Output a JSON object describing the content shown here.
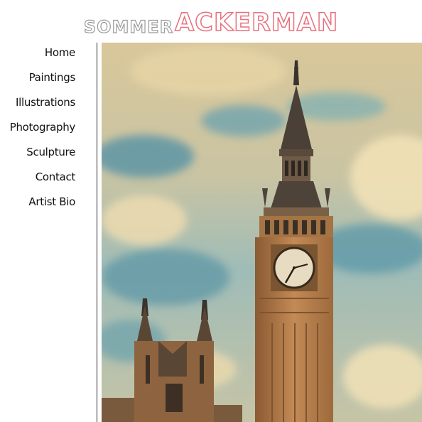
{
  "site": {
    "logo_first": "SOMMER",
    "logo_last": "ACKERMAN"
  },
  "nav": {
    "items": [
      {
        "label": "Home"
      },
      {
        "label": "Paintings"
      },
      {
        "label": "Illustrations"
      },
      {
        "label": "Photography"
      },
      {
        "label": "Sculpture"
      },
      {
        "label": "Contact"
      },
      {
        "label": "Artist Bio"
      }
    ]
  },
  "colors": {
    "logo_first": "#9a9a9a",
    "logo_last": "#e8707e",
    "nav_text": "#111111",
    "divider": "#2a2a2a"
  }
}
